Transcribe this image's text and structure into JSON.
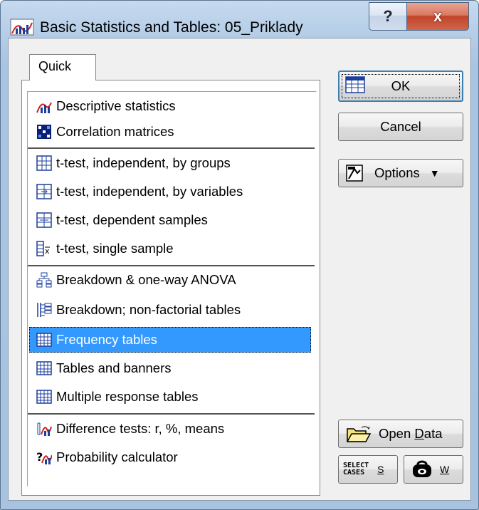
{
  "window": {
    "title": "Basic Statistics and Tables: 05_Priklady",
    "help_label": "?",
    "close_label": "x"
  },
  "tab": {
    "label": "Quick"
  },
  "list": {
    "items": [
      {
        "label": "Descriptive statistics",
        "icon": "descriptive-stats-icon"
      },
      {
        "label": "Correlation matrices",
        "icon": "correlation-matrix-icon"
      },
      {
        "label": "t-test, independent, by groups",
        "icon": "ttest-groups-icon"
      },
      {
        "label": "t-test, independent, by variables",
        "icon": "ttest-variables-icon"
      },
      {
        "label": "t-test, dependent samples",
        "icon": "ttest-dependent-icon"
      },
      {
        "label": "t-test, single sample",
        "icon": "ttest-single-icon"
      },
      {
        "label": "Breakdown & one-way ANOVA",
        "icon": "breakdown-anova-icon"
      },
      {
        "label": "Breakdown; non-factorial tables",
        "icon": "breakdown-nonfactorial-icon"
      },
      {
        "label": "Frequency tables",
        "icon": "frequency-table-icon",
        "selected": true
      },
      {
        "label": "Tables and banners",
        "icon": "tables-banners-icon"
      },
      {
        "label": "Multiple response tables",
        "icon": "multiple-response-icon"
      },
      {
        "label": "Difference tests: r, %, means",
        "icon": "difference-tests-icon"
      },
      {
        "label": "Probability calculator",
        "icon": "probability-calculator-icon"
      }
    ]
  },
  "buttons": {
    "ok": "OK",
    "cancel": "Cancel",
    "options": "Options",
    "open_data_pre": "Open ",
    "open_data_key": "D",
    "open_data_post": "ata",
    "select_cases_line1": "SELECT",
    "select_cases_line2": "CASES",
    "select_cases_key": "S",
    "weight_key": "W"
  },
  "colors": {
    "selection": "#3399ff",
    "title_gradient_top": "#c6daef",
    "close_red": "#c1442a",
    "face": "#f0f0f0"
  }
}
